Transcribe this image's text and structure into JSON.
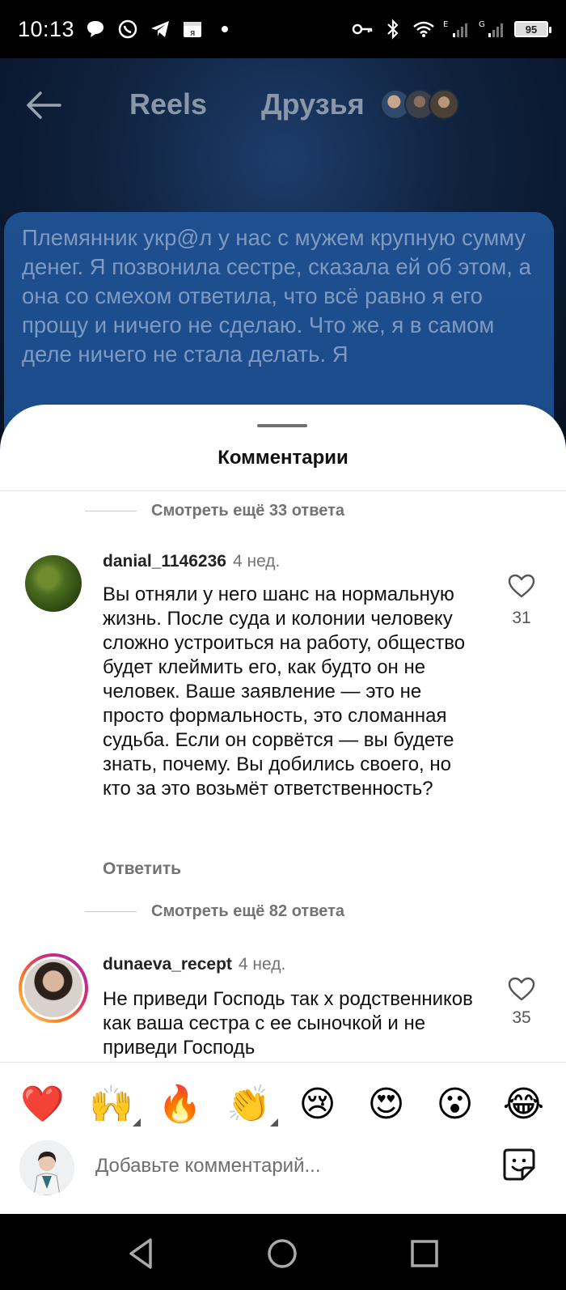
{
  "status_bar": {
    "time": "10:13",
    "battery": "95",
    "network_e": "E",
    "network_g": "G"
  },
  "header": {
    "tab_reels": "Reels",
    "tab_friends": "Друзья"
  },
  "reel": {
    "text": "Племянник укр@л у нас с мужем крупную сумму денег. Я позвонила сестре, сказала ей об этом, а она со смехом ответила, что всё равно я его прощу и ничего не сделаю. Что же, я в самом деле ничего не стала делать. Я"
  },
  "sheet": {
    "title": "Комментарии",
    "more_replies_1": "Смотреть ещё 33 ответа",
    "more_replies_2": "Смотреть ещё 82 ответа",
    "comments": [
      {
        "username": "danial_1146236",
        "ago": "4 нед.",
        "text": "Вы отняли у него шанс на нормальную жизнь. После суда и колонии человеку сложно устроиться на работу, общество будет клеймить его, как будто он не человек. Ваше заявление — это не просто формальность, это сломанная судьба. Если он сорвётся — вы будете знать, почему. Вы добились своего, но кто за это возьмёт ответственность?",
        "reply": "Ответить",
        "likes": "31"
      },
      {
        "username": "dunaeva_recept",
        "ago": "4 нед.",
        "text": "Не приведи Господь так х родственников как ваша сестра с ее сыночкой и не приведи Господь",
        "likes": "35"
      }
    ]
  },
  "emojis": [
    "❤️",
    "🙌",
    "🔥",
    "👏",
    "😢",
    "😍",
    "😮",
    "😂"
  ],
  "input": {
    "placeholder": "Добавьте комментарий..."
  },
  "colors": {
    "accent_gradient": [
      "#feda75",
      "#d62976",
      "#962fbf"
    ],
    "muted_text": "#737373"
  }
}
